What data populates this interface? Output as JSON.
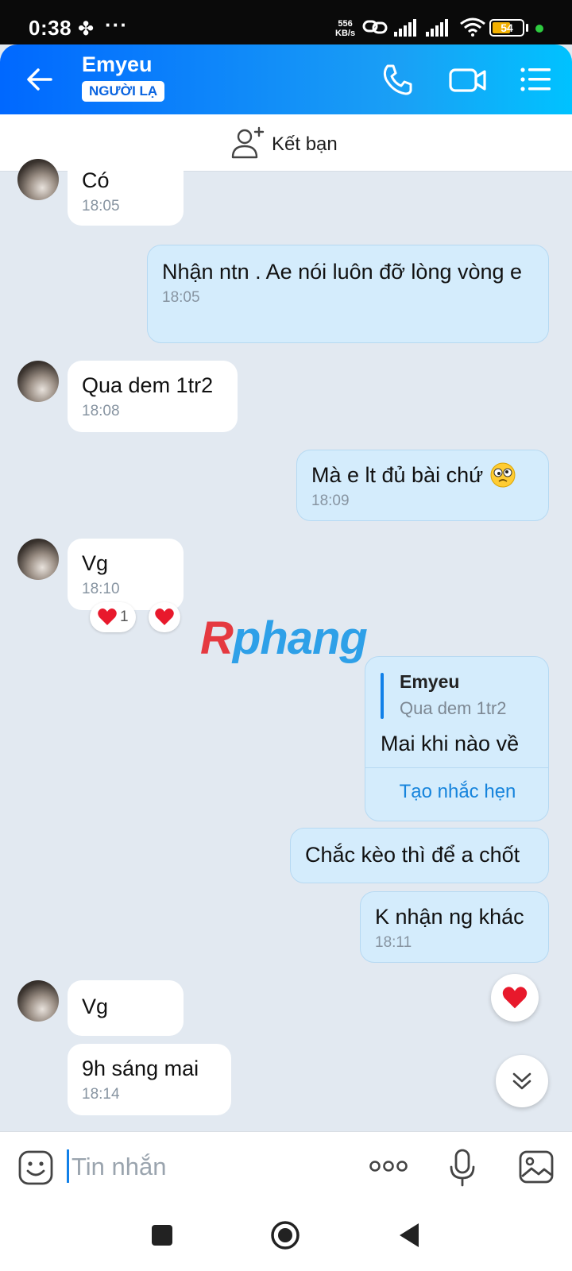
{
  "status_bar": {
    "time": "0:38",
    "net_speed_value": "556",
    "net_speed_unit": "KB/s",
    "battery": "54"
  },
  "header": {
    "name": "Emyeu",
    "badge": "NGƯỜI LẠ"
  },
  "add_friend": {
    "label": "Kết bạn"
  },
  "messages": [
    {
      "side": "in",
      "text": "Có",
      "time": "18:05"
    },
    {
      "side": "out",
      "text": "Nhận ntn . Ae nói luôn đỡ lòng vòng e",
      "time": "18:05"
    },
    {
      "side": "in",
      "text": "Qua dem 1tr2",
      "time": "18:08"
    },
    {
      "side": "out",
      "text": "Mà e lt đủ bài chứ",
      "time": "18:09"
    },
    {
      "side": "in",
      "text": "Vg",
      "time": "18:10",
      "reaction_count": "1"
    },
    {
      "side": "out",
      "quote_name": "Emyeu",
      "quote_text": "Qua dem 1tr2",
      "text": "Mai khi nào về",
      "action": "Tạo nhắc hẹn"
    },
    {
      "side": "out",
      "text": "Chắc kèo thì để a chốt"
    },
    {
      "side": "out",
      "text": "K nhận ng khác",
      "time": "18:11"
    },
    {
      "side": "in",
      "text": "Vg"
    },
    {
      "side": "in",
      "text": "9h sáng mai",
      "time": "18:14"
    }
  ],
  "watermark": {
    "first": "R",
    "rest": "phang"
  },
  "composer": {
    "placeholder": "Tin nhắn"
  },
  "colors": {
    "header_start": "#0068ff",
    "header_end": "#00c2ff",
    "outgoing_bubble": "#d4ecfc",
    "incoming_bubble": "#ffffff",
    "chat_background": "#e2e9f1",
    "heart": "#e8192c"
  }
}
